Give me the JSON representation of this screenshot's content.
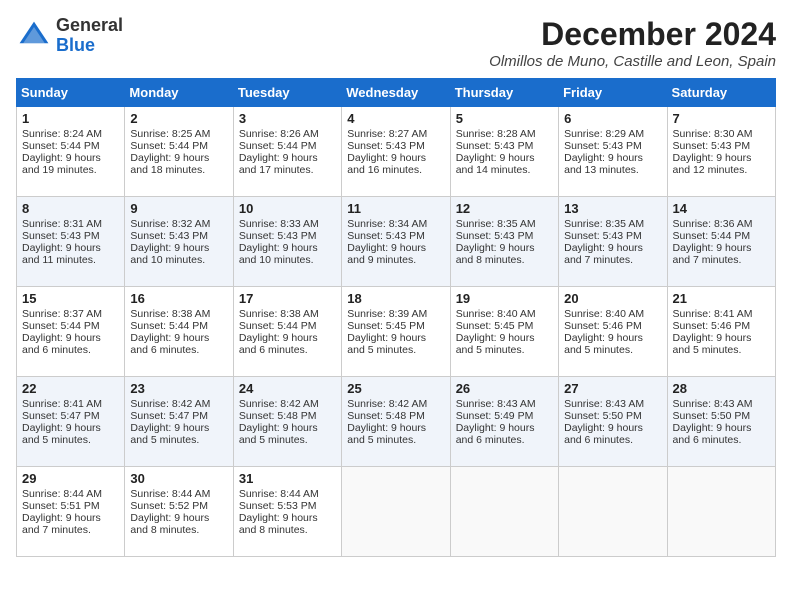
{
  "header": {
    "logo_general": "General",
    "logo_blue": "Blue",
    "month_title": "December 2024",
    "location": "Olmillos de Muno, Castille and Leon, Spain"
  },
  "calendar": {
    "columns": [
      "Sunday",
      "Monday",
      "Tuesday",
      "Wednesday",
      "Thursday",
      "Friday",
      "Saturday"
    ],
    "weeks": [
      [
        {
          "day": "1",
          "lines": [
            "Sunrise: 8:24 AM",
            "Sunset: 5:44 PM",
            "Daylight: 9 hours",
            "and 19 minutes."
          ]
        },
        {
          "day": "2",
          "lines": [
            "Sunrise: 8:25 AM",
            "Sunset: 5:44 PM",
            "Daylight: 9 hours",
            "and 18 minutes."
          ]
        },
        {
          "day": "3",
          "lines": [
            "Sunrise: 8:26 AM",
            "Sunset: 5:44 PM",
            "Daylight: 9 hours",
            "and 17 minutes."
          ]
        },
        {
          "day": "4",
          "lines": [
            "Sunrise: 8:27 AM",
            "Sunset: 5:43 PM",
            "Daylight: 9 hours",
            "and 16 minutes."
          ]
        },
        {
          "day": "5",
          "lines": [
            "Sunrise: 8:28 AM",
            "Sunset: 5:43 PM",
            "Daylight: 9 hours",
            "and 14 minutes."
          ]
        },
        {
          "day": "6",
          "lines": [
            "Sunrise: 8:29 AM",
            "Sunset: 5:43 PM",
            "Daylight: 9 hours",
            "and 13 minutes."
          ]
        },
        {
          "day": "7",
          "lines": [
            "Sunrise: 8:30 AM",
            "Sunset: 5:43 PM",
            "Daylight: 9 hours",
            "and 12 minutes."
          ]
        }
      ],
      [
        {
          "day": "8",
          "lines": [
            "Sunrise: 8:31 AM",
            "Sunset: 5:43 PM",
            "Daylight: 9 hours",
            "and 11 minutes."
          ]
        },
        {
          "day": "9",
          "lines": [
            "Sunrise: 8:32 AM",
            "Sunset: 5:43 PM",
            "Daylight: 9 hours",
            "and 10 minutes."
          ]
        },
        {
          "day": "10",
          "lines": [
            "Sunrise: 8:33 AM",
            "Sunset: 5:43 PM",
            "Daylight: 9 hours",
            "and 10 minutes."
          ]
        },
        {
          "day": "11",
          "lines": [
            "Sunrise: 8:34 AM",
            "Sunset: 5:43 PM",
            "Daylight: 9 hours",
            "and 9 minutes."
          ]
        },
        {
          "day": "12",
          "lines": [
            "Sunrise: 8:35 AM",
            "Sunset: 5:43 PM",
            "Daylight: 9 hours",
            "and 8 minutes."
          ]
        },
        {
          "day": "13",
          "lines": [
            "Sunrise: 8:35 AM",
            "Sunset: 5:43 PM",
            "Daylight: 9 hours",
            "and 7 minutes."
          ]
        },
        {
          "day": "14",
          "lines": [
            "Sunrise: 8:36 AM",
            "Sunset: 5:44 PM",
            "Daylight: 9 hours",
            "and 7 minutes."
          ]
        }
      ],
      [
        {
          "day": "15",
          "lines": [
            "Sunrise: 8:37 AM",
            "Sunset: 5:44 PM",
            "Daylight: 9 hours",
            "and 6 minutes."
          ]
        },
        {
          "day": "16",
          "lines": [
            "Sunrise: 8:38 AM",
            "Sunset: 5:44 PM",
            "Daylight: 9 hours",
            "and 6 minutes."
          ]
        },
        {
          "day": "17",
          "lines": [
            "Sunrise: 8:38 AM",
            "Sunset: 5:44 PM",
            "Daylight: 9 hours",
            "and 6 minutes."
          ]
        },
        {
          "day": "18",
          "lines": [
            "Sunrise: 8:39 AM",
            "Sunset: 5:45 PM",
            "Daylight: 9 hours",
            "and 5 minutes."
          ]
        },
        {
          "day": "19",
          "lines": [
            "Sunrise: 8:40 AM",
            "Sunset: 5:45 PM",
            "Daylight: 9 hours",
            "and 5 minutes."
          ]
        },
        {
          "day": "20",
          "lines": [
            "Sunrise: 8:40 AM",
            "Sunset: 5:46 PM",
            "Daylight: 9 hours",
            "and 5 minutes."
          ]
        },
        {
          "day": "21",
          "lines": [
            "Sunrise: 8:41 AM",
            "Sunset: 5:46 PM",
            "Daylight: 9 hours",
            "and 5 minutes."
          ]
        }
      ],
      [
        {
          "day": "22",
          "lines": [
            "Sunrise: 8:41 AM",
            "Sunset: 5:47 PM",
            "Daylight: 9 hours",
            "and 5 minutes."
          ]
        },
        {
          "day": "23",
          "lines": [
            "Sunrise: 8:42 AM",
            "Sunset: 5:47 PM",
            "Daylight: 9 hours",
            "and 5 minutes."
          ]
        },
        {
          "day": "24",
          "lines": [
            "Sunrise: 8:42 AM",
            "Sunset: 5:48 PM",
            "Daylight: 9 hours",
            "and 5 minutes."
          ]
        },
        {
          "day": "25",
          "lines": [
            "Sunrise: 8:42 AM",
            "Sunset: 5:48 PM",
            "Daylight: 9 hours",
            "and 5 minutes."
          ]
        },
        {
          "day": "26",
          "lines": [
            "Sunrise: 8:43 AM",
            "Sunset: 5:49 PM",
            "Daylight: 9 hours",
            "and 6 minutes."
          ]
        },
        {
          "day": "27",
          "lines": [
            "Sunrise: 8:43 AM",
            "Sunset: 5:50 PM",
            "Daylight: 9 hours",
            "and 6 minutes."
          ]
        },
        {
          "day": "28",
          "lines": [
            "Sunrise: 8:43 AM",
            "Sunset: 5:50 PM",
            "Daylight: 9 hours",
            "and 6 minutes."
          ]
        }
      ],
      [
        {
          "day": "29",
          "lines": [
            "Sunrise: 8:44 AM",
            "Sunset: 5:51 PM",
            "Daylight: 9 hours",
            "and 7 minutes."
          ]
        },
        {
          "day": "30",
          "lines": [
            "Sunrise: 8:44 AM",
            "Sunset: 5:52 PM",
            "Daylight: 9 hours",
            "and 8 minutes."
          ]
        },
        {
          "day": "31",
          "lines": [
            "Sunrise: 8:44 AM",
            "Sunset: 5:53 PM",
            "Daylight: 9 hours",
            "and 8 minutes."
          ]
        },
        {
          "day": "",
          "lines": []
        },
        {
          "day": "",
          "lines": []
        },
        {
          "day": "",
          "lines": []
        },
        {
          "day": "",
          "lines": []
        }
      ]
    ]
  }
}
